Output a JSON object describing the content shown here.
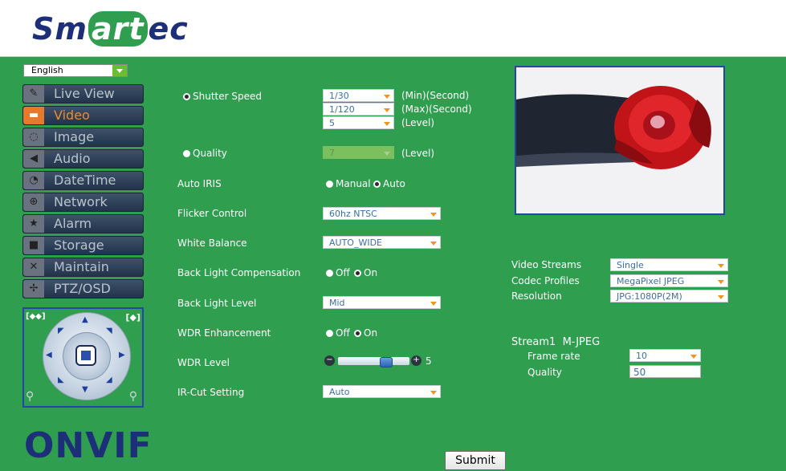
{
  "brand": {
    "logo_pre": "Sm",
    "logo_mid": "art",
    "logo_post": "ec",
    "accent_green": "#2f9e4f",
    "logo_blue": "#1d2f78"
  },
  "language": {
    "selected": "English"
  },
  "sidebar": {
    "items": [
      {
        "label": "Live View",
        "icon": "chat-bubble-icon"
      },
      {
        "label": "Video",
        "icon": "video-camera-icon"
      },
      {
        "label": "Image",
        "icon": "power-ring-icon"
      },
      {
        "label": "Audio",
        "icon": "speaker-icon"
      },
      {
        "label": "DateTime",
        "icon": "clock-icon"
      },
      {
        "label": "Network",
        "icon": "globe-icon"
      },
      {
        "label": "Alarm",
        "icon": "alarm-star-icon"
      },
      {
        "label": "Storage",
        "icon": "storage-folder-icon"
      },
      {
        "label": "Maintain",
        "icon": "tools-icon"
      },
      {
        "label": "PTZ/OSD",
        "icon": "ptz-move-icon"
      }
    ]
  },
  "ptz": {
    "zoom_out_label": "[◆◆]",
    "zoom_in_label": "[◆]"
  },
  "onvif_logo": "ONVIF",
  "video": {
    "shutter_speed": {
      "label": "Shutter Speed",
      "min_value": "1/30",
      "min_suffix": "(Min)(Second)",
      "max_value": "1/120",
      "max_suffix": "(Max)(Second)",
      "level_value": "5",
      "level_suffix": "(Level)"
    },
    "quality": {
      "label": "Quality",
      "value": "7",
      "suffix": "(Level)"
    },
    "auto_iris": {
      "label": "Auto IRIS",
      "option_manual": "Manual",
      "option_auto": "Auto"
    },
    "flicker_control": {
      "label": "Flicker Control",
      "value": "60hz NTSC"
    },
    "white_balance": {
      "label": "White Balance",
      "value": "AUTO_WIDE"
    },
    "blc": {
      "label": "Back Light Compensation",
      "option_off": "Off",
      "option_on": "On"
    },
    "back_light_level": {
      "label": "Back Light Level",
      "value": "Mid"
    },
    "wdr_enhancement": {
      "label": "WDR Enhancement",
      "option_off": "Off",
      "option_on": "On"
    },
    "wdr_level": {
      "label": "WDR Level",
      "value": "5",
      "minus": "−",
      "plus": "+"
    },
    "ir_cut": {
      "label": "IR-Cut Setting",
      "value": "Auto"
    }
  },
  "streams": {
    "video_streams": {
      "label": "Video Streams",
      "value": "Single"
    },
    "codec_profiles": {
      "label": "Codec Profiles",
      "value": "MegaPixel JPEG"
    },
    "resolution": {
      "label": "Resolution",
      "value": "JPG:1080P(2M)"
    },
    "stream1": {
      "title": "Stream1  M-JPEG",
      "frame_rate_label": "Frame rate",
      "frame_rate_value": "10",
      "quality_label": "Quality",
      "quality_value": "50"
    }
  },
  "submit_label": "Submit"
}
